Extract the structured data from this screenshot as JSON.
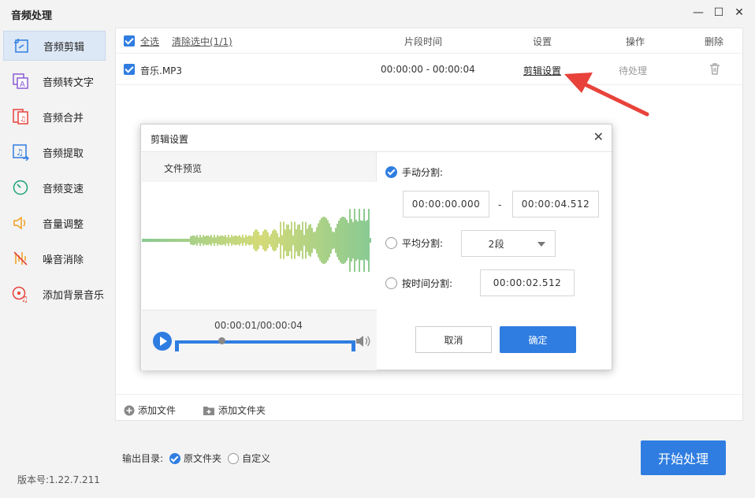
{
  "app": {
    "title": "音频处理",
    "version": "版本号:1.22.7.211"
  },
  "window_controls": {
    "minimize": "—",
    "maximize": "☐",
    "close": "✕"
  },
  "sidebar": {
    "items": [
      {
        "label": "音频剪辑",
        "icon": "audio-cut-icon",
        "active": true
      },
      {
        "label": "音频转文字",
        "icon": "audio-to-text-icon"
      },
      {
        "label": "音频合并",
        "icon": "audio-merge-icon"
      },
      {
        "label": "音频提取",
        "icon": "audio-extract-icon"
      },
      {
        "label": "音频变速",
        "icon": "audio-speed-icon"
      },
      {
        "label": "音量调整",
        "icon": "volume-adjust-icon"
      },
      {
        "label": "噪音消除",
        "icon": "noise-removal-icon"
      },
      {
        "label": "添加背景音乐",
        "icon": "background-music-icon"
      }
    ]
  },
  "table": {
    "select_all": "全选",
    "clear_selected": "清除选中(1/1)",
    "columns": {
      "segment_time": "片段时间",
      "settings": "设置",
      "action": "操作",
      "delete": "删除"
    },
    "rows": [
      {
        "name": "音乐.MP3",
        "segment": "00:00:00 - 00:00:04",
        "settings_link": "剪辑设置",
        "status": "待处理"
      }
    ]
  },
  "bottombar": {
    "add_file": "添加文件",
    "add_folder": "添加文件夹"
  },
  "output": {
    "label": "输出目录:",
    "option_original": "原文件夹",
    "option_custom": "自定义"
  },
  "start_button": "开始处理",
  "dialog": {
    "title": "剪辑设置",
    "preview_title": "文件预览",
    "playback_time": "00:00:01/00:00:04",
    "playback_progress": 0.25,
    "manual_split_label": "手动分割:",
    "manual_start": "00:00:00.000",
    "manual_dash": "-",
    "manual_end": "00:00:04.512",
    "average_split_label": "平均分割:",
    "average_value": "2段",
    "time_split_label": "按时间分割:",
    "time_split_value": "00:00:02.512",
    "cancel": "取消",
    "confirm": "确定"
  },
  "colors": {
    "accent": "#2f7de1",
    "arrow": "#e8423a",
    "wave_start": "#3aa64a",
    "wave_mid": "#b8c21e"
  }
}
